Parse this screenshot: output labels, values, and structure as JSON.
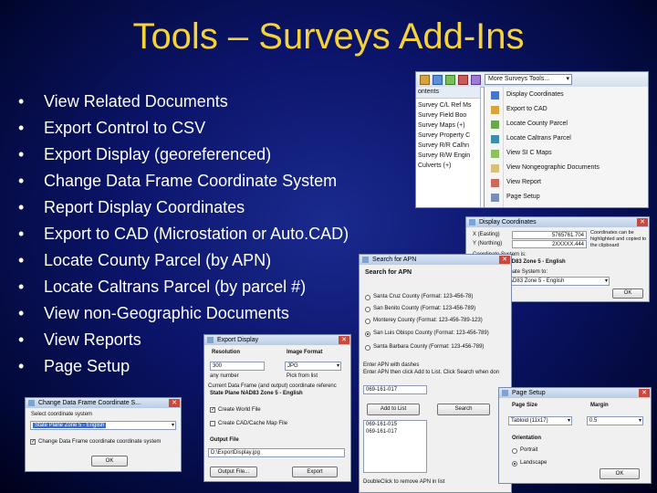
{
  "slide": {
    "title": "Tools – Surveys Add-Ins",
    "bullet_char": "•",
    "bullets": [
      "View Related Documents",
      "Export Control to CSV",
      "Export Display (georeferenced)",
      "Change Data Frame Coordinate System",
      "Report Display Coordinates",
      "Export to CAD (Microstation or Auto.CAD)",
      "Locate County Parcel (by APN)",
      "Locate Caltrans Parcel (by parcel #)",
      "View non-Geographic Documents",
      "View Reports",
      "Page Setup"
    ]
  },
  "menu_window": {
    "toolbar_label": "More Surveys Tools...",
    "dropdown_arrow": "▾",
    "left_panel_header": "ontents",
    "layers": [
      "Survey C/L Ref Ms",
      "Survey Field Boo",
      "Survey Maps (+)",
      "Survey Property C",
      "Survey R/R Calhn",
      "Survey R/W Engin",
      "Culverts (+)"
    ],
    "items": [
      "Display Coordinates",
      "Export to CAD",
      "Locate County Parcel",
      "Locate Caltrans Parcel",
      "View SI C Maps",
      "View Nongeographic Documents",
      "View Report",
      "Page Setup"
    ],
    "icon_names": [
      "xy-icon",
      "cad-export-icon",
      "county-parcel-icon",
      "caltrans-parcel-icon",
      "map-icon",
      "documents-icon",
      "report-icon",
      "page-setup-icon"
    ]
  },
  "display_coords": {
    "title": "Display Coordinates",
    "x_label": "X (Easting)",
    "x_value": "5765761.704",
    "y_label": "Y (Northing)",
    "y_value": "2XXXXX.444",
    "note": "Coordinates can be highlighted and copied to the clipboard",
    "cs_label": "Coordinate System is:",
    "cs_value": "State Plane NAD83 Zone 5 - English",
    "change_label": "Change Coordinate System to:",
    "change_value": "State Plane NAD83 Zone 5 - English",
    "ok": "OK"
  },
  "search_apn": {
    "title": "Search for APN",
    "heading": "Search for APN",
    "options": [
      "Santa Cruz County (Format: 123-456-78)",
      "San Benito County (Format: 123-456-789)",
      "Monterey County (Format: 123-456-789-123)",
      "San Luis Obispo County (Format: 123-456-789)",
      "Santa Barbara County (Format: 123-456-789)"
    ],
    "selected_index": 3,
    "instruction1": "Enter APN with dashes",
    "instruction2": "Enter APN then click Add to List. Click Search when don",
    "input_value": "069-161-017",
    "add_button": "Add to List",
    "search_button": "Search",
    "list": [
      "069-161-015",
      "069-161-017"
    ],
    "footer": "DoubleClick to remove APN in list"
  },
  "export_display": {
    "title": "Export Display",
    "resolution_label": "Resolution",
    "format_label": "Image Format",
    "resolution_value": "300",
    "format_value": "JPG",
    "note1": "any number",
    "note2": "Pick from list",
    "cs_line": "Current Data Frame (and output) coordinate referenc",
    "cs_value": "State Plane NAD83 Zone 5 - English",
    "cb1": "Create World File",
    "cb1_checked": true,
    "cb2": "Create CAD/Cache Map File",
    "cb2_checked": false,
    "output_label": "Output File",
    "output_value": "D:\\ExportDisplay.jpg",
    "output_button": "Output File...",
    "export_button": "Export"
  },
  "change_cs": {
    "title": "Change Data Frame Coordinate S...",
    "label": "Select coordinate system",
    "value": "State Plane Zone 5 - English",
    "checkbox": "Change Data Frame coordinate coordinate system",
    "checkbox_checked": true,
    "ok": "OK"
  },
  "page_setup": {
    "title": "Page Setup",
    "size_label": "Page Size",
    "size_value": "Tabloid (11x17)",
    "margin_label": "Margin",
    "margin_value": "0.5",
    "orientation_label": "Orientation",
    "portrait": "Portrait",
    "landscape": "Landscape",
    "selected": "landscape",
    "ok": "OK"
  },
  "colors": {
    "title": "#f4d23a",
    "text": "#ffffff",
    "bg_center": "#1a2a8e",
    "bg_edge": "#000018",
    "selection": "#3a6ec6"
  }
}
